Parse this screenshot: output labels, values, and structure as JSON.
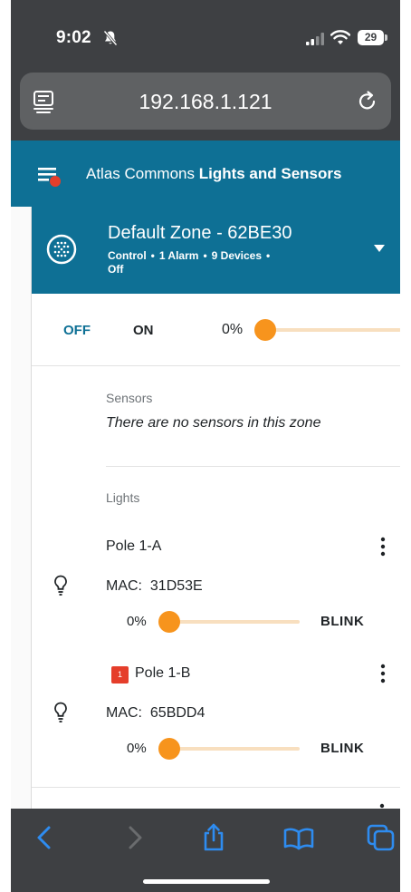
{
  "status_bar": {
    "time": "9:02",
    "battery": "29"
  },
  "browser": {
    "url": "192.168.1.121"
  },
  "app": {
    "title_prefix": "Atlas Commons",
    "title_bold": "Lights and Sensors"
  },
  "zone": {
    "name": "Default Zone - 62BE30",
    "meta": {
      "mode": "Control",
      "alarms": "1 Alarm",
      "devices": "9 Devices",
      "state": "Off"
    },
    "control": {
      "off_label": "OFF",
      "on_label": "ON",
      "level_text": "0%",
      "level": 0
    }
  },
  "sensors": {
    "label": "Sensors",
    "empty_text": "There are no sensors in this zone"
  },
  "lights": {
    "label": "Lights",
    "mac_prefix": "MAC:",
    "items": [
      {
        "name": "Pole 1-A",
        "mac": "31D53E",
        "level_text": "0%",
        "level": 0,
        "blink_label": "BLINK",
        "badge": null
      },
      {
        "name": "Pole 1-B",
        "mac": "65BDD4",
        "level_text": "0%",
        "level": 0,
        "blink_label": "BLINK",
        "badge": "1"
      }
    ]
  },
  "colors": {
    "header_blue": "#0e7095",
    "slider_orange": "#f7941d",
    "slider_track": "#f8dfbf",
    "alarm_red": "#e53e2b",
    "chrome_dark": "#3e4043",
    "link_blue": "#2e8cf0"
  },
  "icons": {
    "status": [
      "bell-slash-icon",
      "cellular-signal-icon",
      "wifi-icon",
      "battery-icon"
    ],
    "browser": [
      "page-menu-icon",
      "reload-icon"
    ],
    "app": [
      "hamburger-menu-icon",
      "zone-grid-icon",
      "chevron-down-icon",
      "lightbulb-icon",
      "kebab-menu-icon"
    ],
    "toolbar": [
      "back-icon",
      "forward-icon",
      "share-icon",
      "bookmarks-icon",
      "tabs-icon"
    ]
  }
}
